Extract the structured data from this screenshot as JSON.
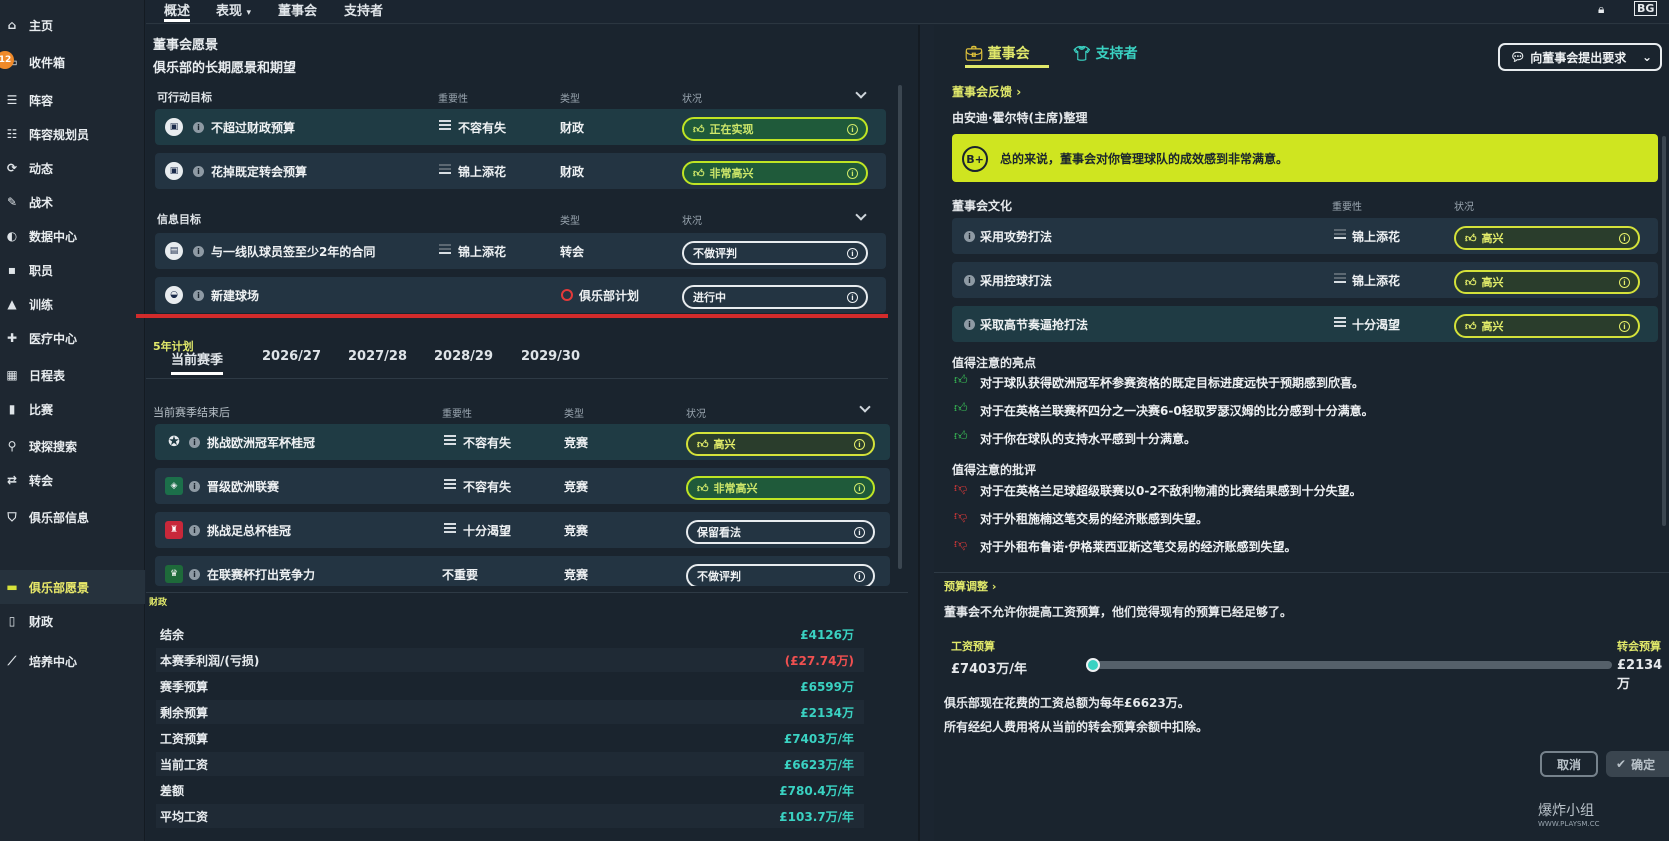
{
  "sidebar": {
    "items": [
      {
        "label": "主页",
        "icon": "home-icon"
      },
      {
        "label": "收件箱",
        "icon": "inbox-icon",
        "badge": "12"
      },
      {
        "label": "阵容",
        "icon": "squad-icon"
      },
      {
        "label": "阵容规划员",
        "icon": "squad-planner-icon"
      },
      {
        "label": "动态",
        "icon": "dynamics-icon"
      },
      {
        "label": "战术",
        "icon": "tactics-icon"
      },
      {
        "label": "数据中心",
        "icon": "data-hub-icon"
      },
      {
        "label": "职员",
        "icon": "staff-icon"
      },
      {
        "label": "训练",
        "icon": "training-icon"
      },
      {
        "label": "医疗中心",
        "icon": "medical-icon"
      },
      {
        "label": "日程表",
        "icon": "calendar-icon"
      },
      {
        "label": "比赛",
        "icon": "match-icon"
      },
      {
        "label": "球探搜索",
        "icon": "scouting-search-icon"
      },
      {
        "label": "转会",
        "icon": "transfers-icon"
      },
      {
        "label": "俱乐部信息",
        "icon": "club-info-icon"
      },
      {
        "label": "俱乐部愿景",
        "icon": "club-vision-icon",
        "active": true
      },
      {
        "label": "财政",
        "icon": "finances-icon"
      },
      {
        "label": "培养中心",
        "icon": "development-icon"
      }
    ]
  },
  "topbar": {
    "tabs": [
      "概述",
      "表现",
      "董事会",
      "支持者"
    ],
    "active_tab": "概述",
    "right_label": "BG"
  },
  "vision": {
    "title": "董事会愿景",
    "subtitle": "俱乐部的长期愿景和期望",
    "actionable": {
      "header": "可行动目标",
      "cols": {
        "importance": "重要性",
        "type": "类型",
        "status": "状况"
      },
      "rows": [
        {
          "label": "不超过财政预算",
          "importance": "不容有失",
          "type": "财政",
          "status": "正在实现",
          "status_kind": "good"
        },
        {
          "label": "花掉既定转会预算",
          "importance": "锦上添花",
          "type": "财政",
          "status": "非常高兴",
          "status_kind": "good"
        }
      ]
    },
    "info": {
      "header": "信息目标",
      "cols": {
        "type": "类型",
        "status": "状况"
      },
      "rows": [
        {
          "label": "与一线队球员签至少2年的合同",
          "importance": "锦上添花",
          "type": "转会",
          "status": "不做评判",
          "status_kind": "neutral"
        },
        {
          "label": "新建球场",
          "importance": "",
          "type": "俱乐部计划",
          "status": "进行中",
          "status_kind": "neutral"
        }
      ]
    },
    "five_year": {
      "title": "5年计划",
      "tabs": [
        "当前赛季",
        "2026/27",
        "2027/28",
        "2028/29",
        "2029/30"
      ],
      "active_tab": "当前赛季",
      "header": "当前赛季结束后",
      "cols": {
        "importance": "重要性",
        "type": "类型",
        "status": "状况"
      },
      "rows": [
        {
          "label": "挑战欧洲冠军杯桂冠",
          "importance": "不容有失",
          "type": "竞赛",
          "status": "高兴",
          "status_kind": "happy"
        },
        {
          "label": "晋级欧洲联赛",
          "importance": "不容有失",
          "type": "竞赛",
          "status": "非常高兴",
          "status_kind": "good"
        },
        {
          "label": "挑战足总杯桂冠",
          "importance": "十分渴望",
          "type": "竞赛",
          "status": "保留看法",
          "status_kind": "neutral"
        },
        {
          "label": "在联赛杯打出竞争力",
          "importance": "不重要",
          "type": "竞赛",
          "status": "不做评判",
          "status_kind": "neutral"
        }
      ]
    }
  },
  "finance": {
    "title": "财政",
    "rows": [
      {
        "label": "结余",
        "value": "£4126万",
        "negative": false
      },
      {
        "label": "本赛季利润/(亏损)",
        "value": "(£27.74万)",
        "negative": true
      },
      {
        "label": "赛季预算",
        "value": "£6599万",
        "negative": false
      },
      {
        "label": "剩余预算",
        "value": "£2134万",
        "negative": false
      },
      {
        "label": "工资预算",
        "value": "£7403万/年",
        "negative": false
      },
      {
        "label": "当前工资",
        "value": "£6623万/年",
        "negative": false
      },
      {
        "label": "差额",
        "value": "£780.4万/年",
        "negative": false
      },
      {
        "label": "平均工资",
        "value": "£103.7万/年",
        "negative": false
      }
    ]
  },
  "right": {
    "tabs": [
      "董事会",
      "支持者"
    ],
    "active_tab": "董事会",
    "request_button": "向董事会提出要求",
    "feedback_title": "董事会反馈",
    "feedback_by": "由安迪·霍尔特(主席)整理",
    "grade": "B+",
    "feedback_text": "总的来说，董事会对你管理球队的成效感到非常满意。",
    "culture": {
      "header": "董事会文化",
      "cols": {
        "importance": "重要性",
        "status": "状况"
      },
      "rows": [
        {
          "label": "采用攻势打法",
          "importance": "锦上添花",
          "status": "高兴"
        },
        {
          "label": "采用控球打法",
          "importance": "锦上添花",
          "status": "高兴"
        },
        {
          "label": "采取高节奏逼抢打法",
          "importance": "十分渴望",
          "status": "高兴"
        }
      ]
    },
    "highlights": {
      "header": "值得注意的亮点",
      "items": [
        "对于球队获得欧洲冠军杯参赛资格的既定目标进度远快于预期感到欣喜。",
        "对于在英格兰联赛杯四分之一决赛6-0轻取罗瑟汉姆的比分感到十分满意。",
        "对于你在球队的支持水平感到十分满意。"
      ]
    },
    "criticisms": {
      "header": "值得注意的批评",
      "items": [
        "对于在英格兰足球超级联赛以0-2不敌利物浦的比赛结果感到十分失望。",
        "对于外租施楠这笔交易的经济账感到失望。",
        "对于外租布鲁诺·伊格莱西亚斯这笔交易的经济账感到失望。"
      ]
    },
    "budget": {
      "title": "预算调整",
      "message": "董事会不允许你提高工资预算，他们觉得现有的预算已经足够了。",
      "wage_label": "工资预算",
      "wage_value": "£7403万/年",
      "transfer_label": "转会预算",
      "transfer_value": "£2134万",
      "slider_fraction": 0.0,
      "note1": "俱乐部现在花费的工资总额为每年£6623万。",
      "note2": "所有经纪人费用将从当前的转会预算余额中扣除。",
      "cancel": "取消",
      "confirm": "确定"
    },
    "watermark": "爆炸小组",
    "watermark_url": "WWW.PLAYSM.CC"
  }
}
